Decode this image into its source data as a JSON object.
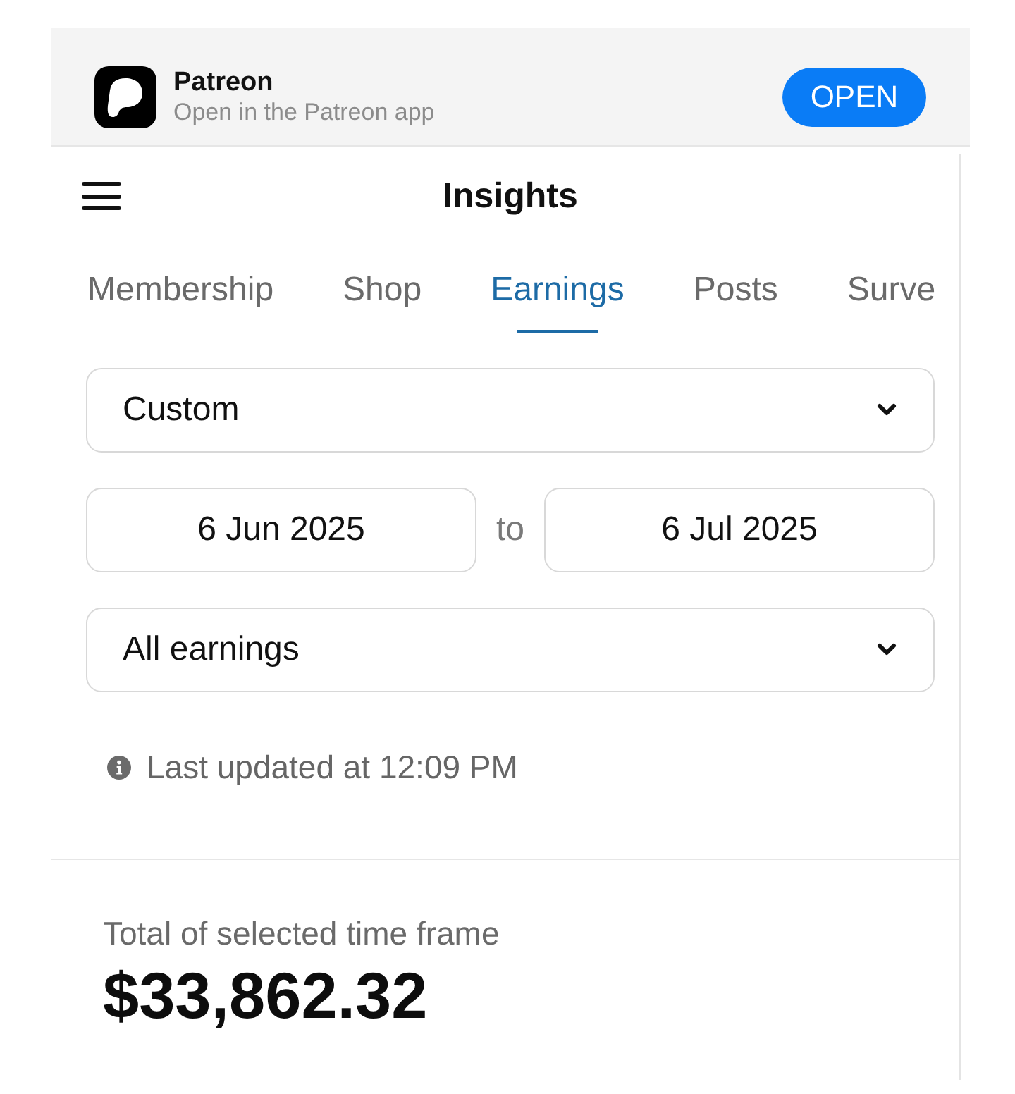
{
  "banner": {
    "app_name": "Patreon",
    "subtitle": "Open in the Patreon app",
    "button": "OPEN"
  },
  "header": {
    "title": "Insights"
  },
  "tabs": [
    {
      "label": "Membership",
      "selected": false
    },
    {
      "label": "Shop",
      "selected": false
    },
    {
      "label": "Earnings",
      "selected": true
    },
    {
      "label": "Posts",
      "selected": false
    },
    {
      "label": "Surve",
      "selected": false
    }
  ],
  "filters": {
    "range_select": {
      "value": "Custom"
    },
    "date_from": "6 Jun 2025",
    "date_separator": "to",
    "date_to": "6 Jul 2025",
    "type_select": {
      "value": "All earnings"
    }
  },
  "last_updated": "Last updated at 12:09 PM",
  "total": {
    "label": "Total of selected time frame",
    "amount": "$33,862.32"
  }
}
